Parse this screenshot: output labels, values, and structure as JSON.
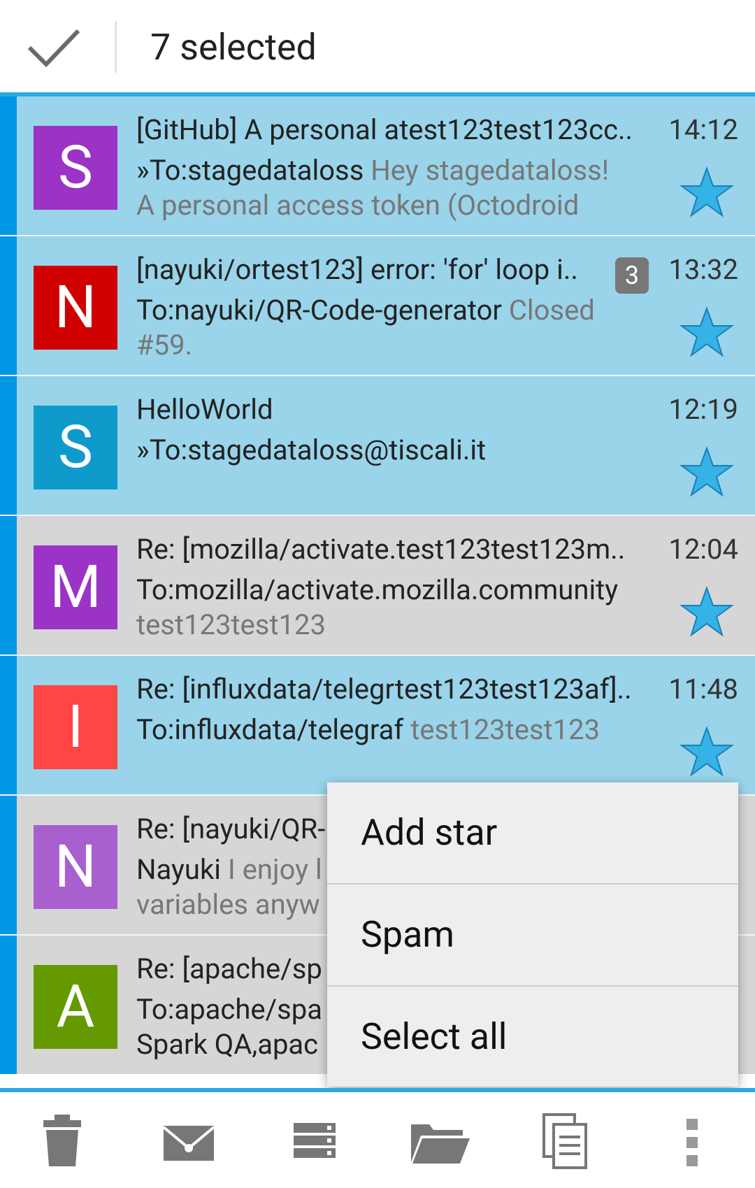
{
  "header": {
    "title": "7 selected"
  },
  "messages": [
    {
      "initial": "S",
      "avatar_color": "#9a33c6",
      "subject": "[GitHub] A personal atest123test123cc..",
      "time": "14:12",
      "to": "»To:stagedataloss",
      "preview": "Hey stagedataloss!",
      "line3": "A personal access token (Octodroid",
      "selected": true,
      "starred": true
    },
    {
      "initial": "N",
      "avatar_color": "#d10000",
      "subject": "[nayuki/ortest123] error: 'for' loop i..",
      "badge": "3",
      "time": "13:32",
      "to": "To:nayuki/QR-Code-generator",
      "preview": "Closed",
      "line3": "#59.",
      "selected": true,
      "starred": true
    },
    {
      "initial": "S",
      "avatar_color": "#0e9bcc",
      "subject": "HelloWorld",
      "time": "12:19",
      "to": "»To:stagedataloss@tiscali.it",
      "preview": "",
      "line3": "",
      "selected": true,
      "starred": true
    },
    {
      "initial": "M",
      "avatar_color": "#9a33c6",
      "subject": "Re: [mozilla/activate.test123test123m..",
      "time": "12:04",
      "to": "To:mozilla/activate.mozilla.community",
      "preview": "",
      "line3": "test123test123",
      "selected": false,
      "starred": true
    },
    {
      "initial": "I",
      "avatar_color": "#ff4545",
      "subject": "Re: [influxdata/telegrtest123test123af]..",
      "time": "11:48",
      "to": "To:influxdata/telegraf",
      "preview": "test123test123",
      "line3": "",
      "selected": true,
      "starred": true
    },
    {
      "initial": "N",
      "avatar_color": "#a960cf",
      "subject": "Re: [nayuki/QR-",
      "time": "",
      "to": "Nayuki",
      "preview": "I enjoy l",
      "line3": "variables anyw",
      "selected": false,
      "starred": false
    },
    {
      "initial": "A",
      "avatar_color": "#649a00",
      "subject": "Re: [apache/sp",
      "time": "",
      "to": "To:apache/spa",
      "preview": "",
      "line3": "Spark QA,apac",
      "line3_dark": true,
      "selected": false,
      "starred": false
    }
  ],
  "menu": {
    "items": [
      "Add star",
      "Spam",
      "Select all"
    ]
  },
  "bottom_bar": {
    "icons": [
      "delete-icon",
      "mark-read-icon",
      "labels-icon",
      "move-to-folder-icon",
      "copy-icon",
      "more-vert-icon"
    ]
  },
  "colors": {
    "selected_row": "#99d4ea",
    "unselected_row": "#d6d6d6",
    "accent": "#29a9e0",
    "star": "#35b2e6"
  }
}
